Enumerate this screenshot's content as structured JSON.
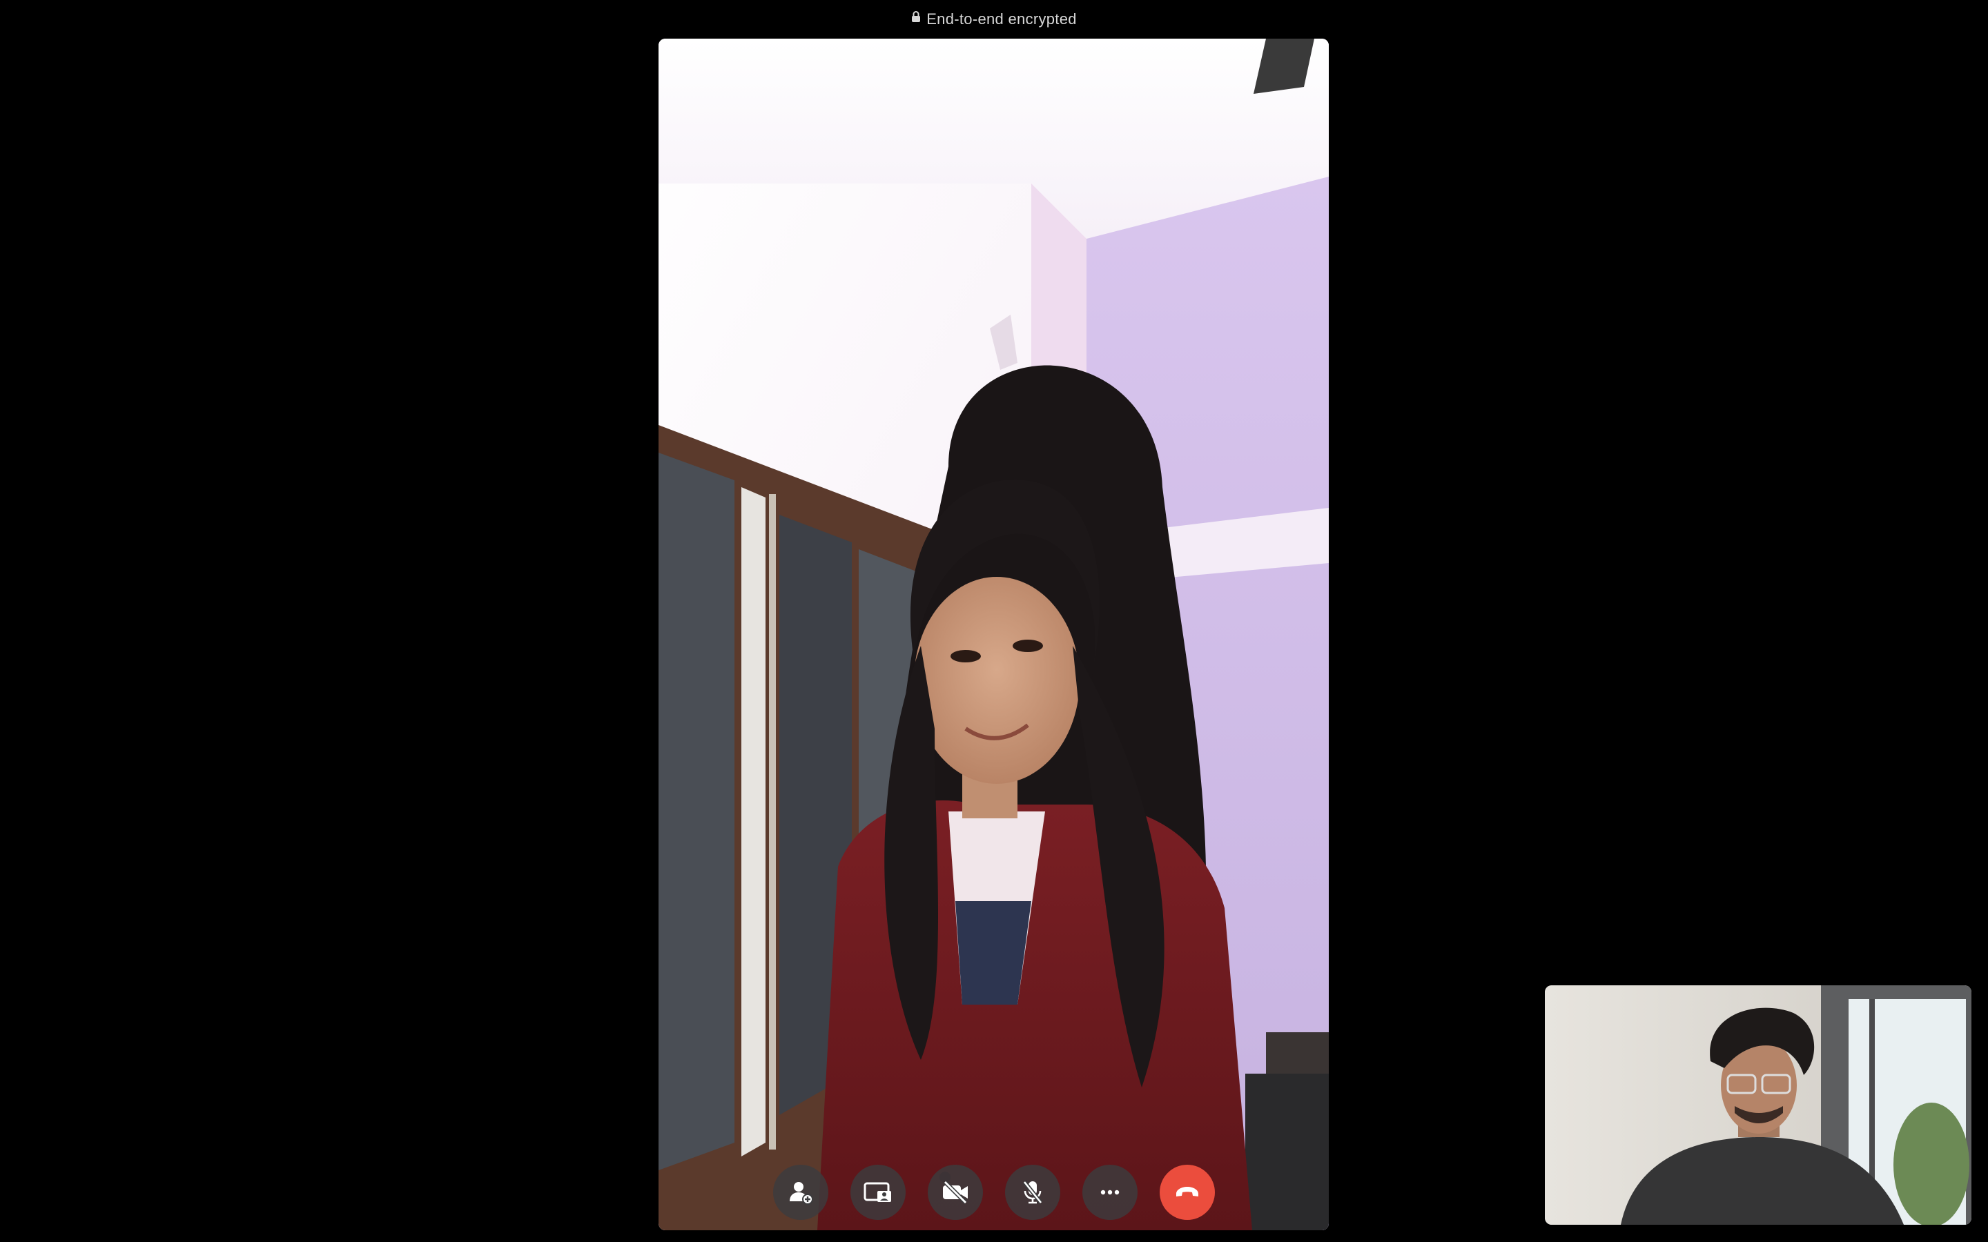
{
  "header": {
    "encryption_text": "End-to-end encrypted",
    "lock_icon": "lock-icon"
  },
  "remote_participant": {
    "video": "remote-video-feed"
  },
  "self_view": {
    "video": "self-video-feed"
  },
  "controls": [
    {
      "name": "add-person-button",
      "icon": "person-add-icon"
    },
    {
      "name": "screen-share-button",
      "icon": "screen-share-icon"
    },
    {
      "name": "camera-off-button",
      "icon": "video-off-icon"
    },
    {
      "name": "mute-button",
      "icon": "mic-off-icon"
    },
    {
      "name": "more-options-button",
      "icon": "more-icon"
    },
    {
      "name": "end-call-button",
      "icon": "phone-hangup-icon"
    }
  ],
  "colors": {
    "background": "#000000",
    "control_bg": "#3c3c3e",
    "end_call": "#eb4d3d",
    "label_text": "#d8d8d8"
  }
}
